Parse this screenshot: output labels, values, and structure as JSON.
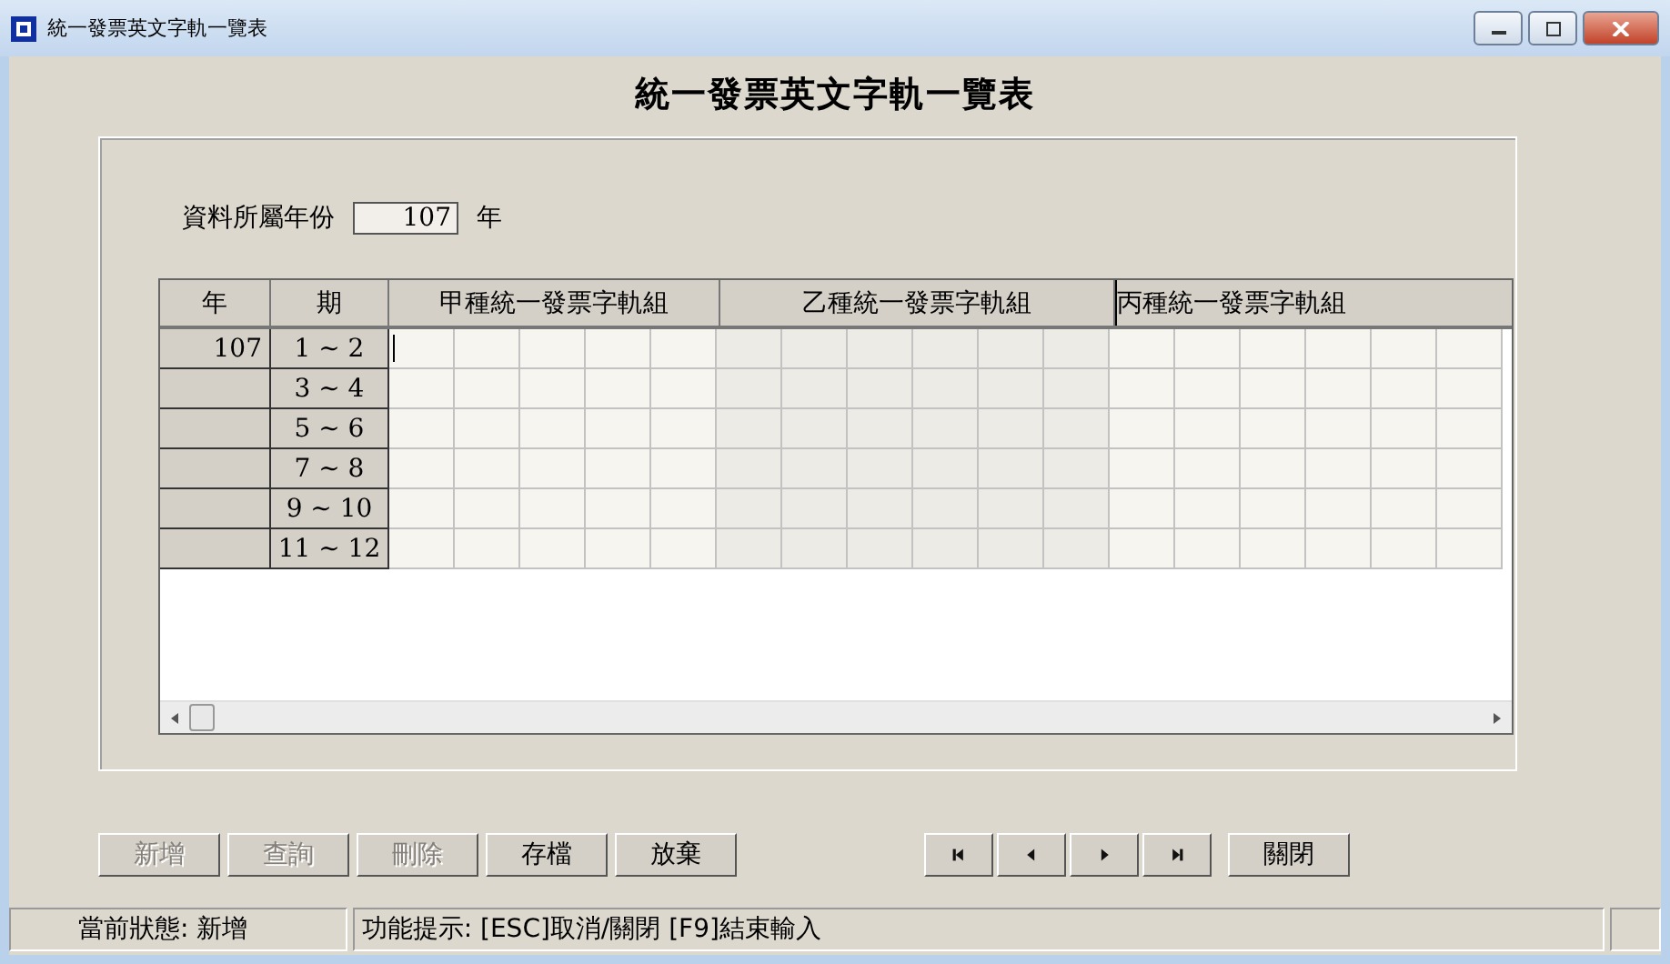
{
  "window": {
    "title": "統一發票英文字軌一覽表"
  },
  "heading": "統一發票英文字軌一覽表",
  "year_field": {
    "label": "資料所屬年份",
    "value": "107",
    "unit": "年"
  },
  "table": {
    "columns": [
      "年",
      "期",
      "甲種統一發票字軌組",
      "乙種統一發票字軌組",
      "丙種統一發票字軌組"
    ],
    "rows": [
      {
        "year": "107",
        "period": "1 ~ 2",
        "cursor": true
      },
      {
        "period": "3 ~ 4",
        "cursor": false
      },
      {
        "period": "5 ~ 6",
        "cursor": false
      },
      {
        "period": "7 ~ 8",
        "cursor": false
      },
      {
        "period": "9 ~ 10",
        "cursor": false
      },
      {
        "period": "11 ~ 12",
        "cursor": false
      }
    ]
  },
  "buttons": [
    {
      "label": "新增",
      "disabled": true
    },
    {
      "label": "查詢",
      "disabled": true
    },
    {
      "label": "刪除",
      "disabled": true
    },
    {
      "label": "存檔",
      "disabled": false
    },
    {
      "label": "放棄",
      "disabled": false
    }
  ],
  "nav_buttons": [
    {
      "kind": "first"
    },
    {
      "kind": "prev"
    },
    {
      "kind": "next"
    },
    {
      "kind": "last"
    }
  ],
  "close_button": {
    "label": "關閉"
  },
  "status_bar": {
    "state": "當前狀態: 新增",
    "hint": "功能提示: [ESC]取消/關閉 [F9]結束輸入"
  }
}
